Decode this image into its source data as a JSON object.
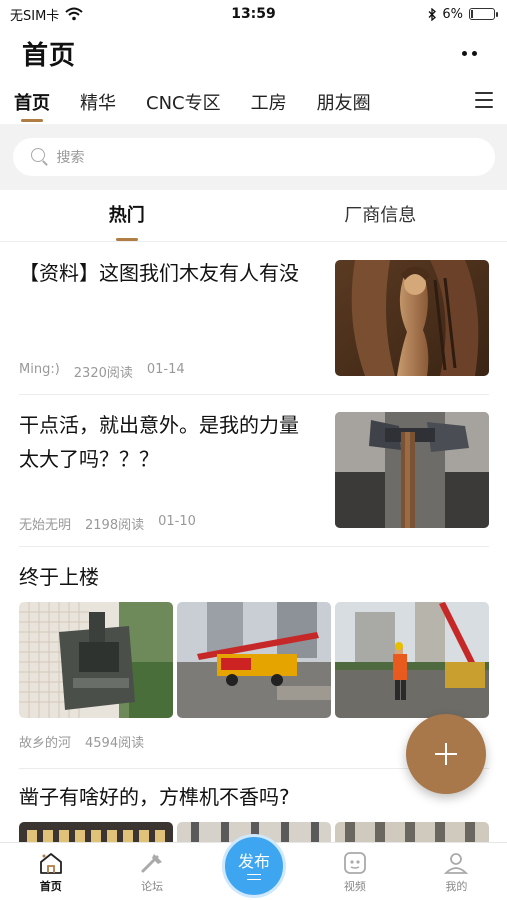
{
  "status_bar": {
    "carrier": "无SIM卡",
    "time": "13:59",
    "battery": "6%",
    "battery_level": 0.06
  },
  "header": {
    "title": "首页"
  },
  "channels": [
    {
      "label": "首页",
      "active": true
    },
    {
      "label": "精华",
      "active": false
    },
    {
      "label": "CNC专区",
      "active": false
    },
    {
      "label": "工房",
      "active": false
    },
    {
      "label": "朋友圈",
      "active": false
    }
  ],
  "search": {
    "placeholder": "搜索"
  },
  "subtabs": [
    {
      "label": "热门",
      "active": true
    },
    {
      "label": "厂商信息",
      "active": false
    }
  ],
  "posts": [
    {
      "title": "【资料】这图我们木友有人有没",
      "author": "Ming:)",
      "reads": "2320阅读",
      "date": "01-14"
    },
    {
      "title": "干点活，就出意外。是我的力量太大了吗？？？",
      "author": "无始无明",
      "reads": "2198阅读",
      "date": "01-10"
    },
    {
      "title": "终于上楼",
      "author": "故乡的河",
      "reads": "4594阅读",
      "date": ""
    },
    {
      "title": "凿子有啥好的，方榫机不香吗?"
    }
  ],
  "bottom_nav": [
    {
      "label": "首页",
      "icon": "home-icon",
      "active": true
    },
    {
      "label": "论坛",
      "icon": "forum-icon",
      "active": false
    },
    {
      "label": "发布",
      "icon": "publish-icon",
      "active": false
    },
    {
      "label": "视频",
      "icon": "video-icon",
      "active": false
    },
    {
      "label": "我的",
      "icon": "profile-icon",
      "active": false
    }
  ],
  "colors": {
    "accent": "#b07d45",
    "fab": "#a8774a",
    "publish": "#3ea6f0"
  }
}
